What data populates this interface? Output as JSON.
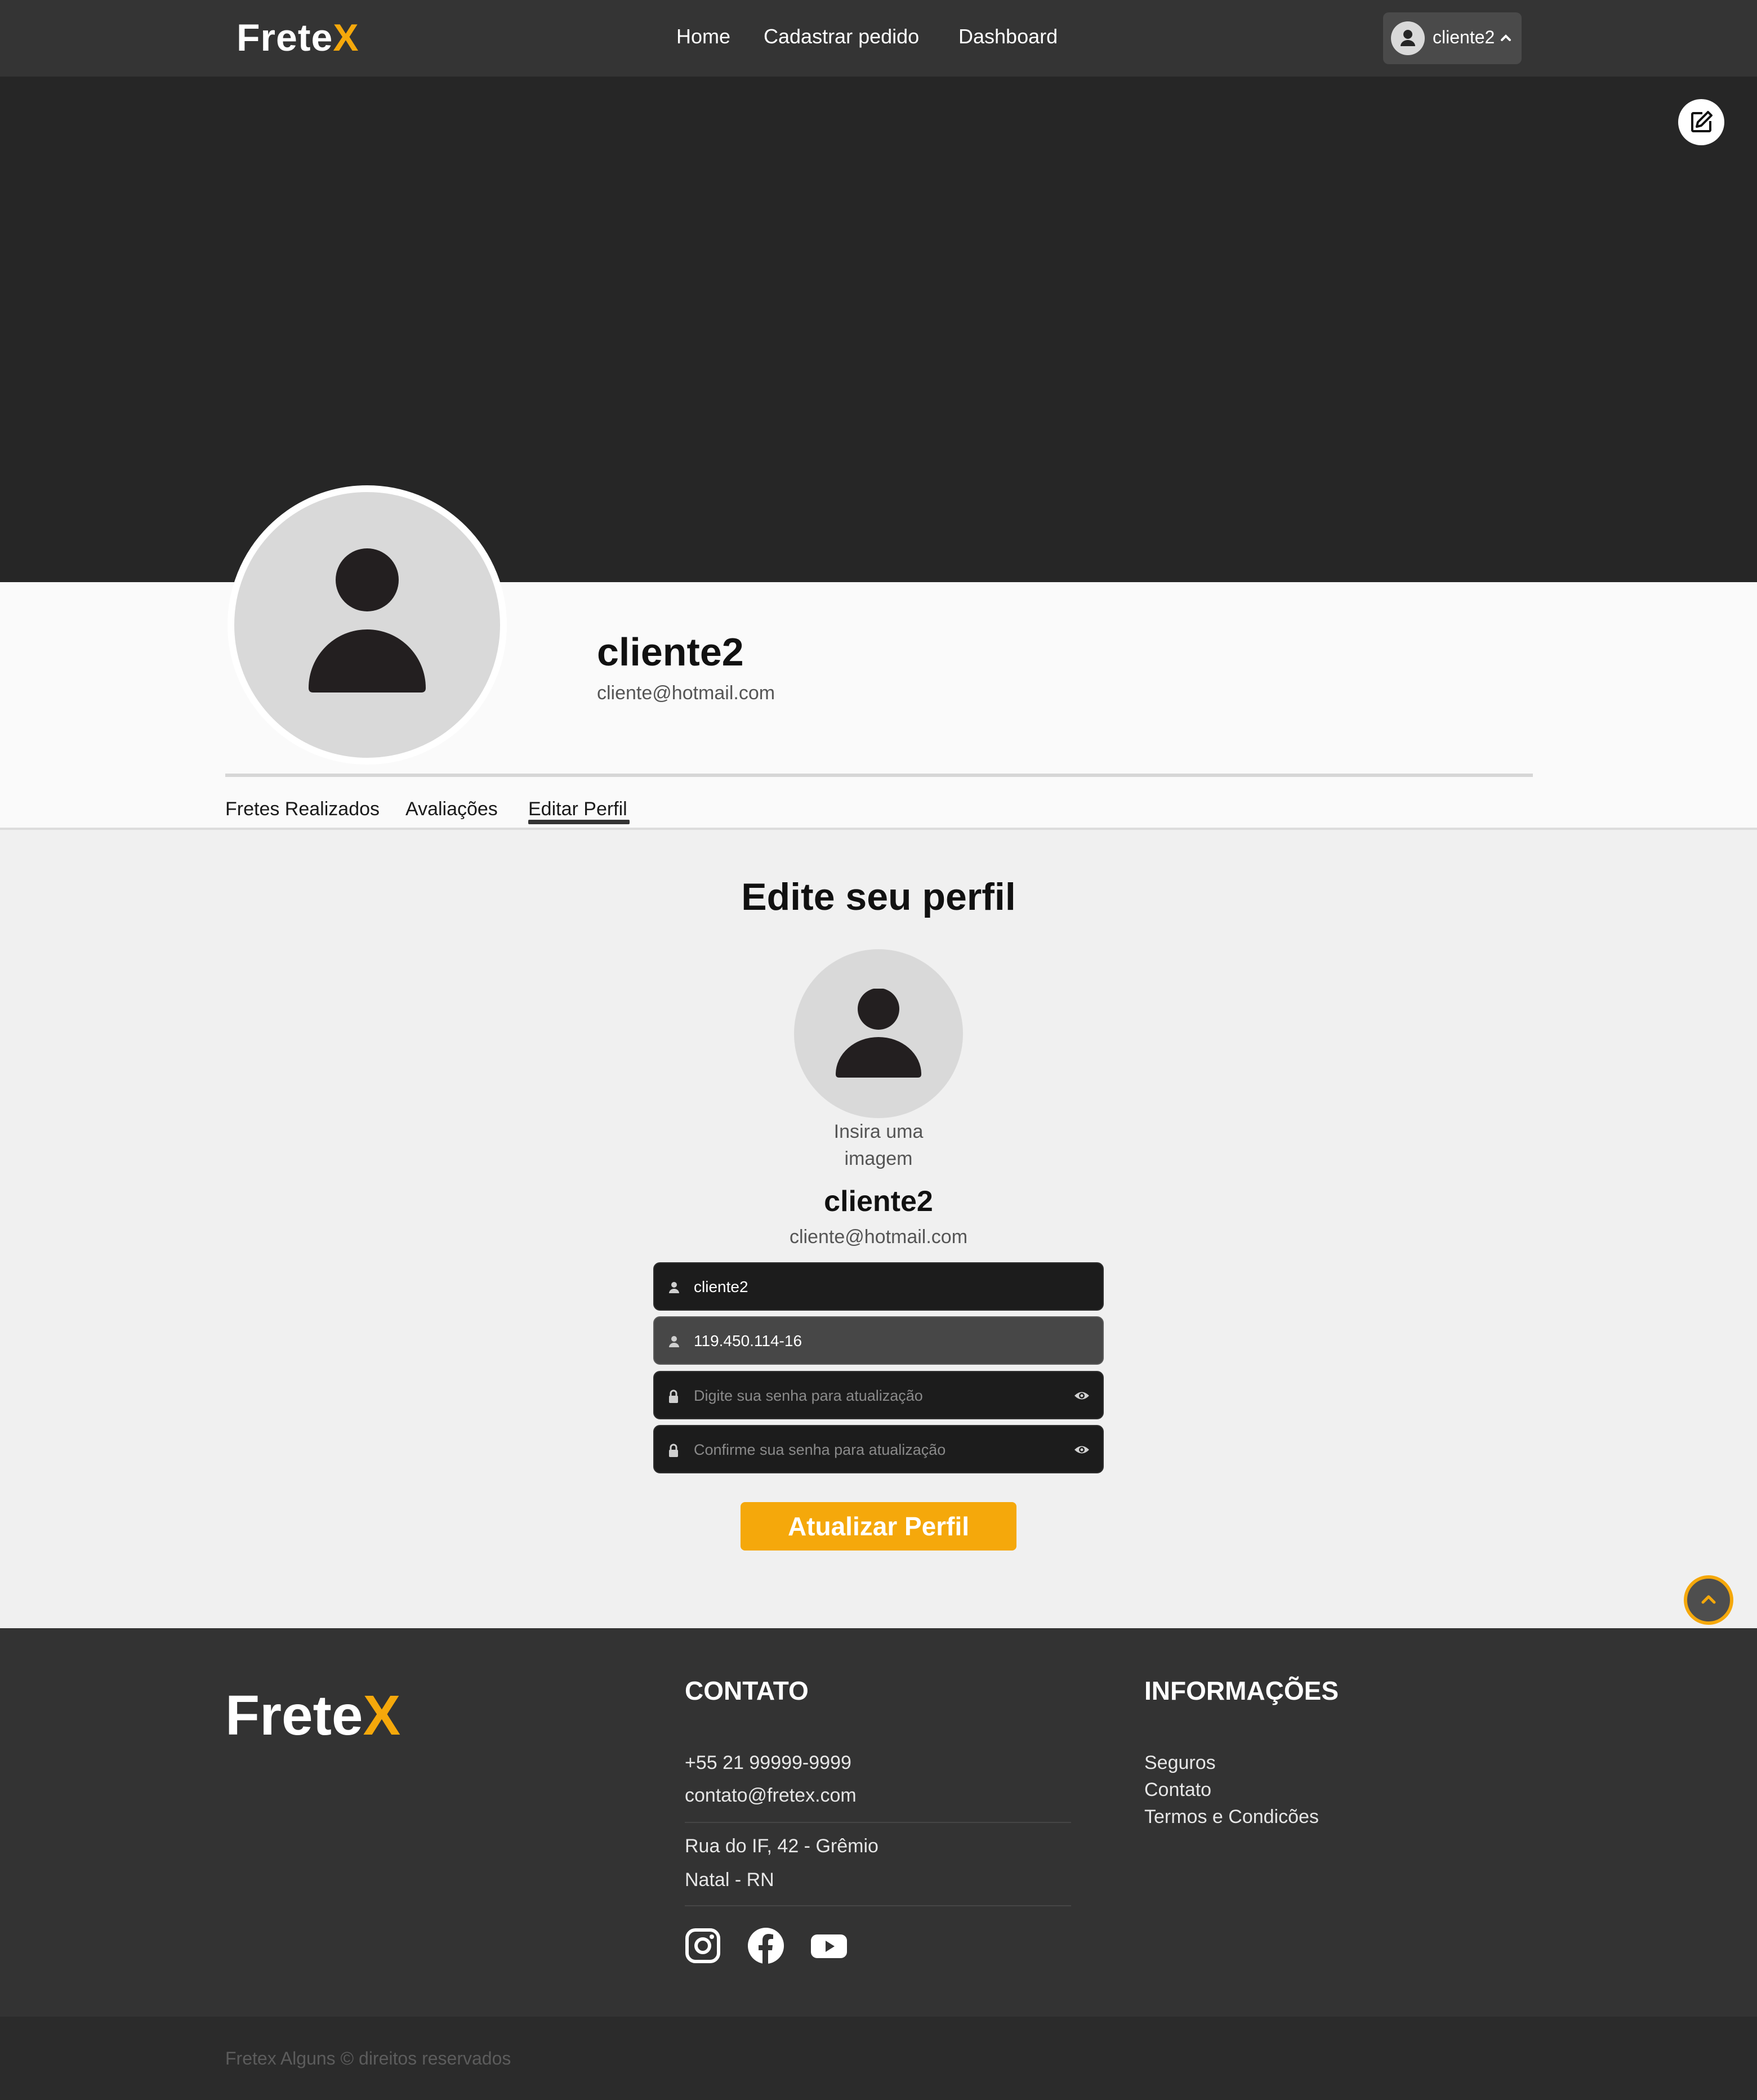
{
  "navbar": {
    "logo_main": "Frete",
    "logo_accent": "X",
    "links": [
      "Home",
      "Cadastrar pedido",
      "Dashboard"
    ],
    "user_name": "cliente2"
  },
  "profile": {
    "name": "cliente2",
    "email": "cliente@hotmail.com",
    "tabs": [
      "Fretes Realizados",
      "Avaliações",
      "Editar Perfil"
    ],
    "active_tab": "Editar Perfil"
  },
  "edit_form": {
    "title": "Edite seu perfil",
    "insert_image_line1": "Insira uma",
    "insert_image_line2": "imagem",
    "name": "cliente2",
    "email": "cliente@hotmail.com",
    "username_value": "cliente2",
    "document_value": "119.450.114-16",
    "password_placeholder": "Digite sua senha para atualização",
    "confirm_password_placeholder": "Confirme sua senha para atualização",
    "submit_label": "Atualizar Perfil"
  },
  "footer": {
    "logo_main": "Frete",
    "logo_accent": "X",
    "contact_heading": "CONTATO",
    "phone": "+55 21 99999-9999",
    "email": "contato@fretex.com",
    "address_line1": "Rua do IF, 42 - Grêmio",
    "address_line2": "Natal - RN",
    "info_heading": "INFORMAÇÕES",
    "info_links": [
      "Seguros",
      "Contato",
      "Termos e Condicões"
    ],
    "social_icons": [
      "instagram-icon",
      "facebook-icon",
      "youtube-icon"
    ],
    "copyright": "Fretex Alguns © direitos reservados"
  },
  "colors": {
    "accent": "#f5a80b",
    "navbar": "#343434",
    "banner": "#262626",
    "footer": "#333333"
  }
}
